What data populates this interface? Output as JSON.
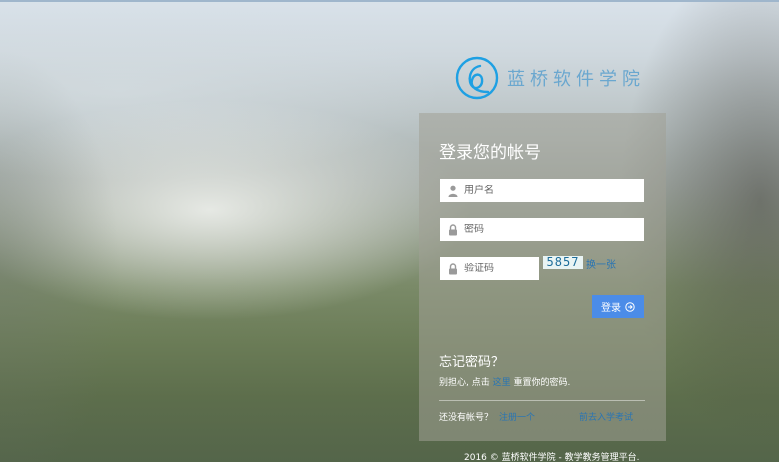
{
  "brand": {
    "name": "蓝桥软件学院",
    "accent_color": "#1ea0e3"
  },
  "login": {
    "title": "登录您的帐号",
    "username_placeholder": "用户名",
    "password_placeholder": "密码",
    "captcha_placeholder": "验证码",
    "captcha_value": "5857",
    "captcha_refresh": "换一张",
    "submit_label": "登录",
    "submit_color": "#4b8ce8"
  },
  "forgot": {
    "title": "忘记密码？",
    "text_before": "别担心, 点击 ",
    "link": "这里",
    "text_after": " 重置你的密码."
  },
  "register": {
    "prompt": "还没有帐号？",
    "link": "注册一个",
    "exam_link": "前去入学考试"
  },
  "footer": {
    "copyright": "2016 © 蓝桥软件学院 - 教学教务管理平台."
  }
}
